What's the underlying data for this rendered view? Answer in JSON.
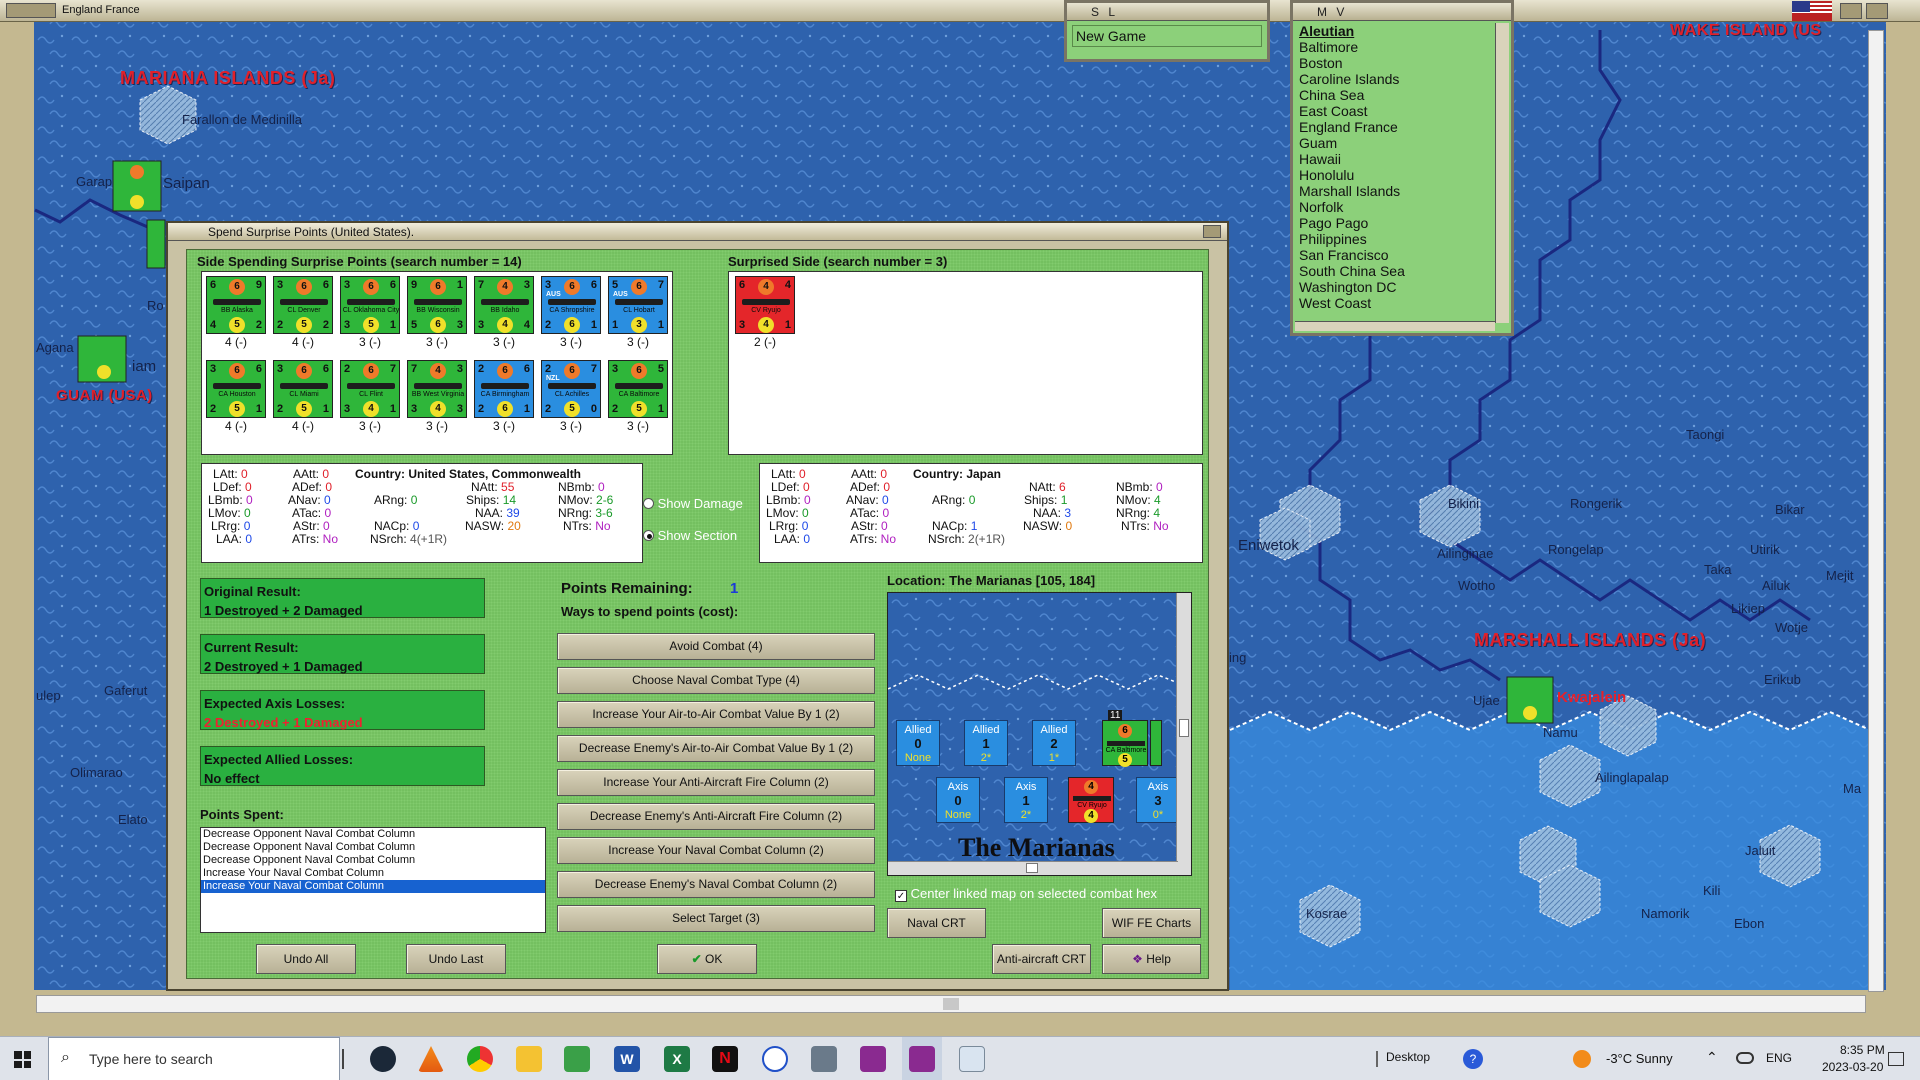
{
  "window": {
    "title": "England France"
  },
  "map": {
    "labels": {
      "mariana": "MARIANA ISLANDS (Ja)",
      "guam": "GUAM (USA)",
      "marshall": "MARSHALL ISLANDS (Ja)",
      "wake": "WAKE ISLAND (US",
      "farallon": "Farallon de Medinilla",
      "saipan": "Saipan",
      "garapan": "Garap",
      "agana": "Agana",
      "ro": "Ro",
      "jam": "iam",
      "ulep": "ulep",
      "gaferut": "Gaferut",
      "olimarao": "Olimarao",
      "elato": "Elato",
      "eniwetok": "Eniwetok",
      "bikini": "Bikini",
      "rongerik": "Rongerik",
      "ailinginae": "Ailinginae",
      "rongelap": "Rongelap",
      "wotho": "Wotho",
      "kwajalein": "Kwajalein",
      "ujae": "Ujae",
      "namu": "Namu",
      "ailinglapalap": "Ailinglapalap",
      "taongi": "Taongi",
      "bikar": "Bikar",
      "utirik": "Utirik",
      "taka": "Taka",
      "ailuk": "Ailuk",
      "mejit": "Mejit",
      "likiep": "Likiep",
      "wotje": "Wotje",
      "erikub": "Erikub",
      "jaluit": "Jaluit",
      "kili": "Kili",
      "namorik": "Namorik",
      "ebon": "Ebon",
      "kosrae": "Kosrae",
      "ma": "Ma",
      "ing": "ing"
    }
  },
  "sl_window": {
    "title": "S L",
    "item": "New Game"
  },
  "mv_window": {
    "title": "M V",
    "items": [
      "Aleutian",
      "Baltimore",
      "Boston",
      "Caroline Islands",
      "China Sea",
      "East Coast",
      "England France",
      "Guam",
      "Hawaii",
      "Honolulu",
      "Marshall Islands",
      "Norfolk",
      "Pago Pago",
      "Philippines",
      "San Francisco",
      "South China Sea",
      "Washington DC",
      "West Coast"
    ]
  },
  "dialog": {
    "title": "Spend Surprise Points (United States).",
    "spending_header": "Side Spending Surprise Points (search number = 14)",
    "surprised_header": "Surprised Side (search number = 3)",
    "spending_units": [
      {
        "name": "BB Alaska",
        "color": "#2fb63a",
        "tl": "6",
        "tr": "9",
        "att": "6",
        "def": "5",
        "bl": "4",
        "br": "2",
        "cap": "4 (-)"
      },
      {
        "name": "CL Denver",
        "color": "#2fb63a",
        "tl": "3",
        "tr": "6",
        "att": "6",
        "def": "5",
        "bl": "2",
        "br": "2",
        "cap": "4 (-)"
      },
      {
        "name": "CL Oklahoma City",
        "color": "#2fb63a",
        "tl": "3",
        "tr": "6",
        "att": "6",
        "def": "5",
        "bl": "3",
        "br": "1",
        "cap": "3 (-)"
      },
      {
        "name": "BB Wisconsin",
        "color": "#2fb63a",
        "tl": "9",
        "tr": "1",
        "att": "6",
        "def": "6",
        "bl": "5",
        "br": "3",
        "cap": "3 (-)"
      },
      {
        "name": "BB Idaho",
        "color": "#2fb63a",
        "tl": "7",
        "tr": "3",
        "att": "4",
        "def": "4",
        "bl": "3",
        "br": "4",
        "cap": "3 (-)"
      },
      {
        "name": "CA Shropshire",
        "color": "#2a8ee0",
        "tl": "3",
        "tr": "6",
        "att": "6",
        "def": "6",
        "bl": "2",
        "br": "1",
        "cap": "3 (-)",
        "flag": "AUS"
      },
      {
        "name": "CL Hobart",
        "color": "#2a8ee0",
        "tl": "5",
        "tr": "7",
        "att": "6",
        "def": "3",
        "bl": "1",
        "br": "1",
        "cap": "3 (-)",
        "flag": "AUS"
      },
      {
        "name": "CA Houston",
        "color": "#2fb63a",
        "tl": "3",
        "tr": "6",
        "att": "6",
        "def": "5",
        "bl": "2",
        "br": "1",
        "cap": "4 (-)"
      },
      {
        "name": "CL Miami",
        "color": "#2fb63a",
        "tl": "3",
        "tr": "6",
        "att": "6",
        "def": "5",
        "bl": "2",
        "br": "1",
        "cap": "4 (-)"
      },
      {
        "name": "CL Flint",
        "color": "#2fb63a",
        "tl": "2",
        "tr": "7",
        "att": "6",
        "def": "4",
        "bl": "3",
        "br": "1",
        "cap": "3 (-)"
      },
      {
        "name": "BB West Virginia",
        "color": "#2fb63a",
        "tl": "7",
        "tr": "3",
        "att": "4",
        "def": "4",
        "bl": "3",
        "br": "3",
        "cap": "3 (-)"
      },
      {
        "name": "CA Birmingham",
        "color": "#2a8ee0",
        "tl": "2",
        "tr": "6",
        "att": "6",
        "def": "6",
        "bl": "2",
        "br": "1",
        "cap": "3 (-)"
      },
      {
        "name": "CL Achilles",
        "color": "#2a8ee0",
        "tl": "2",
        "tr": "7",
        "att": "6",
        "def": "5",
        "bl": "2",
        "br": "0",
        "cap": "3 (-)",
        "flag": "NZL"
      },
      {
        "name": "CA Baltimore",
        "color": "#2fb63a",
        "tl": "3",
        "tr": "5",
        "att": "6",
        "def": "5",
        "bl": "2",
        "br": "1",
        "cap": "3 (-)"
      }
    ],
    "surprised_units": [
      {
        "name": "CV Ryujo",
        "color": "#e4262a",
        "tl": "6",
        "tr": "4",
        "att": "4",
        "def": "4",
        "bl": "3",
        "br": "1",
        "cap": "2 (-)"
      }
    ],
    "us_stats": {
      "country": "Country: United States, Commonwealth",
      "LAtt": "0",
      "LDef": "0",
      "LBmb": "0",
      "LMov": "0",
      "LRrg": "0",
      "LAA": "0",
      "AAtt": "0",
      "ADef": "0",
      "ANav": "0",
      "ATac": "0",
      "AStr": "0",
      "ATrs": "No",
      "ARng": "0",
      "NACp": "0",
      "NSrch": "4(+1R)",
      "NAtt": "55",
      "Ships": "14",
      "NAA": "39",
      "NASW": "20",
      "NBmb": "0",
      "NMov": "2-6",
      "NRng": "3-6",
      "NTrs": "No"
    },
    "jp_stats": {
      "country": "Country: Japan",
      "LAtt": "0",
      "LDef": "0",
      "LBmb": "0",
      "LMov": "0",
      "LRrg": "0",
      "LAA": "0",
      "AAtt": "0",
      "ADef": "0",
      "ANav": "0",
      "ATac": "0",
      "AStr": "0",
      "ATrs": "No",
      "ARng": "0",
      "NACp": "1",
      "NSrch": "2(+1R)",
      "NAtt": "6",
      "Ships": "1",
      "NAA": "3",
      "NASW": "0",
      "NBmb": "0",
      "NMov": "4",
      "NRng": "4",
      "NTrs": "No"
    },
    "show_damage": "Show Damage",
    "show_section": "Show Section",
    "original_result_label": "Original Result:",
    "original_result": "1 Destroyed + 2 Damaged",
    "current_result_label": "Current Result:",
    "current_result": "2 Destroyed + 1 Damaged",
    "expected_axis_label": "Expected Axis Losses:",
    "expected_axis": "2 Destroyed + 1 Damaged",
    "expected_allied_label": "Expected Allied Losses:",
    "expected_allied": "No effect",
    "points_spent_label": "Points Spent:",
    "points_spent": [
      "Decrease Opponent Naval Combat Column",
      "Decrease Opponent Naval Combat Column",
      "Decrease Opponent Naval Combat Column",
      "Increase Your Naval Combat Column",
      "Increase Your Naval Combat Column"
    ],
    "points_remaining_label": "Points Remaining:",
    "points_remaining": "1",
    "ways_label": "Ways to spend points (cost):",
    "options": [
      "Avoid Combat (4)",
      "Choose Naval Combat Type (4)",
      "Increase Your Air-to-Air Combat Value By 1 (2)",
      "Decrease Enemy's Air-to-Air Combat Value By 1 (2)",
      "Increase Your Anti-Aircraft Fire Column (2)",
      "Decrease Enemy's Anti-Aircraft Fire Column (2)",
      "Increase Your Naval Combat Column (2)",
      "Decrease Enemy's Naval Combat Column (2)",
      "Select Target (3)"
    ],
    "location": "Location: The Marianas [105, 184]",
    "map_title": "The Marianas",
    "allied_boxes": [
      {
        "label": "Allied",
        "num": "0",
        "sub": "None"
      },
      {
        "label": "Allied",
        "num": "1",
        "sub": "2*"
      },
      {
        "label": "Allied",
        "num": "2",
        "sub": "1*"
      }
    ],
    "axis_boxes": [
      {
        "label": "Axis",
        "num": "0",
        "sub": "None"
      },
      {
        "label": "Axis",
        "num": "1",
        "sub": "2*"
      },
      {
        "label": "Axis",
        "num": "3",
        "sub": "0*"
      }
    ],
    "stack_count": "11",
    "center_map": "Center linked map on selected combat hex",
    "buttons": {
      "naval_crt": "Naval CRT",
      "wif_fe": "WIF FE Charts",
      "undo_all": "Undo All",
      "undo_last": "Undo Last",
      "ok": "OK",
      "aa_crt": "Anti-aircraft CRT",
      "help": "Help"
    }
  },
  "taskbar": {
    "search": "Type here to search",
    "desktop": "Desktop",
    "weather": "-3°C  Sunny",
    "lang": "ENG",
    "time": "8:35 PM",
    "date": "2023-03-20"
  }
}
